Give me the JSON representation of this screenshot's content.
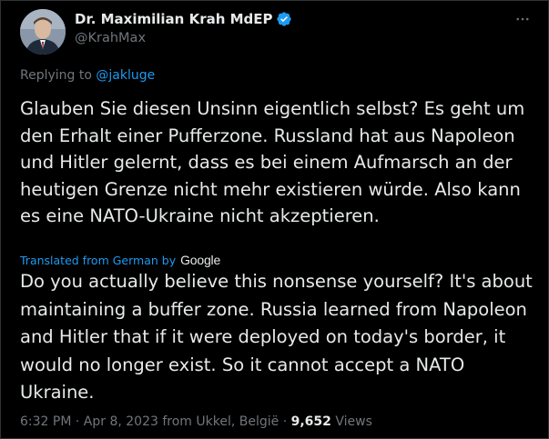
{
  "author": {
    "display_name": "Dr. Maximilian Krah MdEP",
    "handle": "@KrahMax",
    "verified_icon": "verified-badge-icon",
    "verified_color": "#1d9bf0"
  },
  "reply": {
    "prefix": "Replying to ",
    "mention": "@jakluge"
  },
  "tweet": {
    "original_text": "Glauben Sie diesen Unsinn eigentlich selbst? Es geht um den Erhalt einer Pufferzone. Russland hat aus Napoleon und Hitler gelernt, dass es bei einem Aufmarsch an der heutigen Grenze nicht mehr existieren würde. Also kann es eine NATO-Ukraine nicht akzeptieren.",
    "translated_label": "Translated from German by",
    "translator_brand": "Google",
    "translated_text": "Do you actually believe this nonsense yourself? It's about maintaining a buffer zone. Russia learned from Napoleon and Hitler that if it were deployed on today's border, it would no longer exist. So it cannot accept a NATO Ukraine."
  },
  "meta": {
    "time": "6:32 PM",
    "date": "Apr 8, 2023",
    "location": "from Ukkel, België",
    "views_count": "9,652",
    "views_label": "Views",
    "separator": " · "
  },
  "icons": {
    "more": "more-horizontal-icon",
    "avatar": "avatar"
  },
  "colors": {
    "background": "#000000",
    "text": "#e7e9ea",
    "secondary": "#71767b",
    "accent": "#1d9bf0"
  }
}
